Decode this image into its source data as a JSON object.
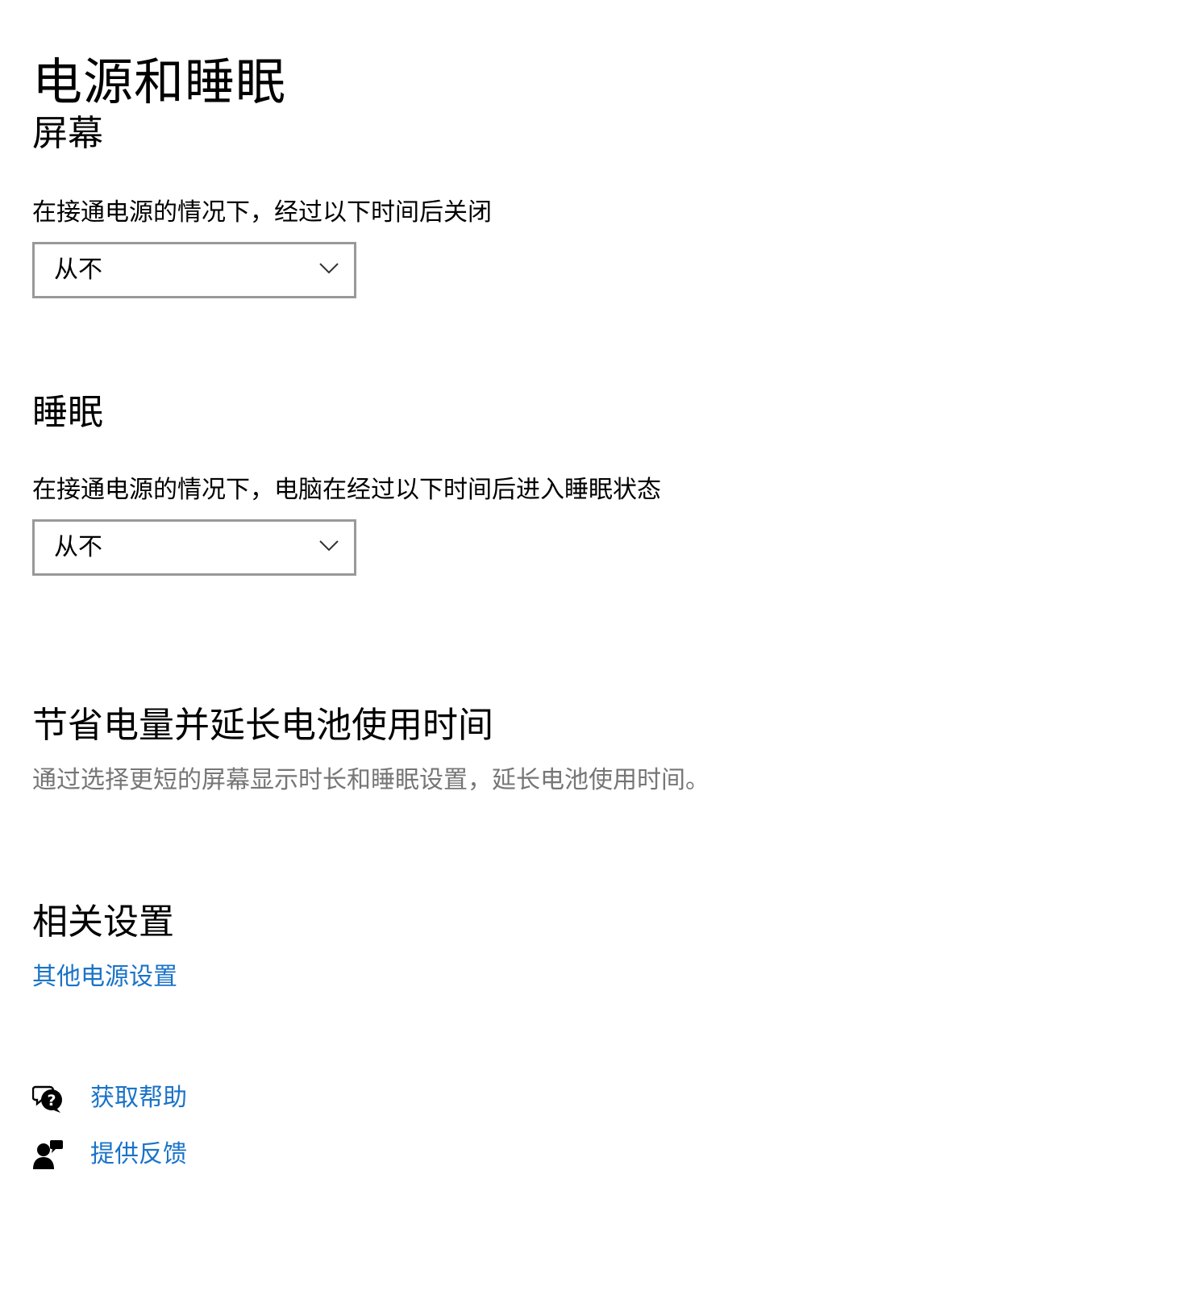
{
  "page": {
    "title": "电源和睡眠"
  },
  "screen": {
    "heading": "屏幕",
    "label": "在接通电源的情况下，经过以下时间后关闭",
    "value": "从不"
  },
  "sleep": {
    "heading": "睡眠",
    "label": "在接通电源的情况下，电脑在经过以下时间后进入睡眠状态",
    "value": "从不"
  },
  "battery": {
    "heading": "节省电量并延长电池使用时间",
    "description": "通过选择更短的屏幕显示时长和睡眠设置，延长电池使用时间。"
  },
  "related": {
    "heading": "相关设置",
    "link": "其他电源设置"
  },
  "footer": {
    "help": {
      "label": "获取帮助",
      "icon": "get-help-icon"
    },
    "feedback": {
      "label": "提供反馈",
      "icon": "feedback-icon"
    }
  },
  "colors": {
    "link": "#1a73c8",
    "secondary_text": "#767676",
    "dropdown_border": "#999999"
  }
}
